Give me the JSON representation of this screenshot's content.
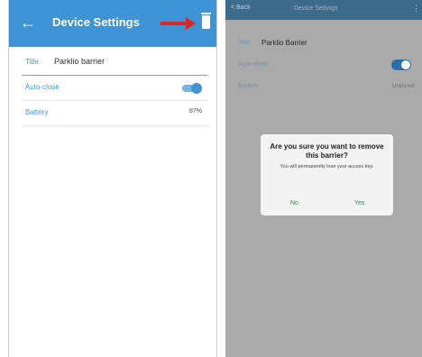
{
  "left": {
    "header": {
      "title": "Device Settings",
      "back_icon": "arrow-left-icon",
      "delete_icon": "trash-icon"
    },
    "rows": {
      "title_label": "Title",
      "title_value": "Parklio barrier",
      "autoclose_label": "Auto-close",
      "autoclose_on": true,
      "battery_label": "Battery",
      "battery_value": "87%"
    },
    "annotation_color": "#d9262c"
  },
  "right": {
    "header": {
      "back": "< Back",
      "title": "Device Settings",
      "more": "⋮"
    },
    "rows": {
      "title_label": "Title",
      "title_value": "Parklio Barrier",
      "autoclose_label": "Auto-close",
      "autoclose_on": true,
      "battery_label": "Battery",
      "battery_value": "Unknown"
    },
    "dialog": {
      "title": "Are you sure you want to remove this barrier?",
      "message": "You will permanently lose your access key.",
      "no": "No",
      "yes": "Yes"
    }
  },
  "colors": {
    "header_blue": "#3d93d3",
    "accent_green": "#2f8f5f"
  }
}
